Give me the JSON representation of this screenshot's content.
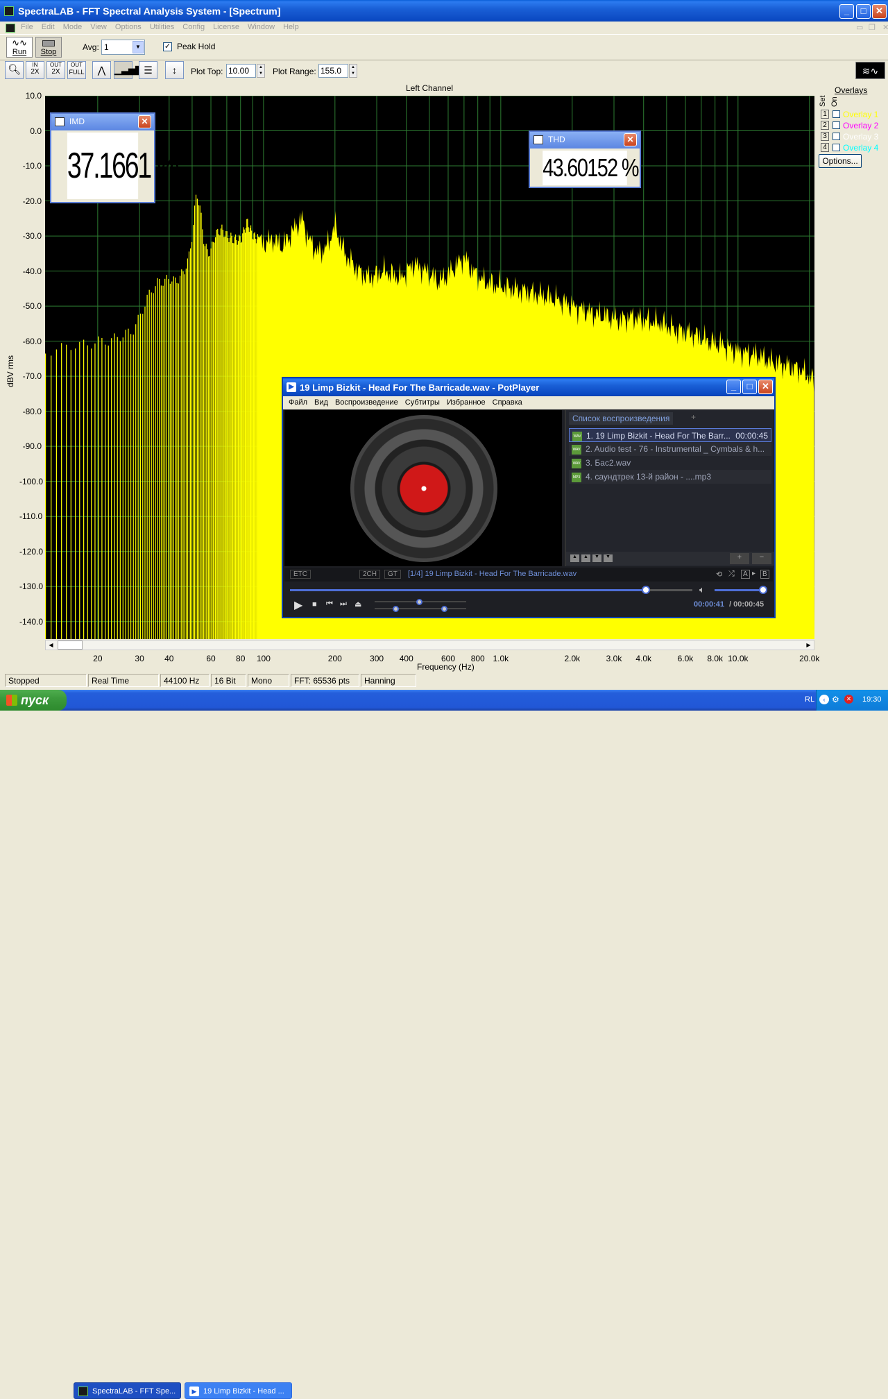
{
  "main_window": {
    "title": "SpectraLAB - FFT Spectral Analysis System - [Spectrum]",
    "menu": [
      "File",
      "Edit",
      "Mode",
      "View",
      "Options",
      "Utilities",
      "Config",
      "License",
      "Window",
      "Help"
    ],
    "run_label": "Run",
    "stop_label": "Stop",
    "avg_label": "Avg:",
    "avg_value": "1",
    "peak_hold_label": "Peak Hold",
    "plot_top_label": "Plot Top:",
    "plot_top_value": "10.00",
    "plot_range_label": "Plot Range:",
    "plot_range_value": "155.0",
    "zoom_buttons": [
      {
        "top": "IN",
        "bottom": "2X"
      },
      {
        "top": "OUT",
        "bottom": "2X"
      },
      {
        "top": "OUT",
        "bottom": "FULL"
      }
    ]
  },
  "chart_data": {
    "type": "bar",
    "title": "Left Channel",
    "xlabel": "Frequency (Hz)",
    "ylabel": "dBV rms",
    "ylim": [
      -145,
      10
    ],
    "xscale": "log",
    "xlim": [
      12,
      21000
    ],
    "y_ticks": [
      "10.0",
      "0.0",
      "-10.0",
      "-20.0",
      "-30.0",
      "-40.0",
      "-50.0",
      "-60.0",
      "-70.0",
      "-80.0",
      "-90.0",
      "-100.0",
      "-110.0",
      "-120.0",
      "-130.0",
      "-140.0"
    ],
    "x_ticks": [
      {
        "label": "20",
        "v": 20
      },
      {
        "label": "30",
        "v": 30
      },
      {
        "label": "40",
        "v": 40
      },
      {
        "label": "60",
        "v": 60
      },
      {
        "label": "80",
        "v": 80
      },
      {
        "label": "100",
        "v": 100
      },
      {
        "label": "200",
        "v": 200
      },
      {
        "label": "300",
        "v": 300
      },
      {
        "label": "400",
        "v": 400
      },
      {
        "label": "600",
        "v": 600
      },
      {
        "label": "800",
        "v": 800
      },
      {
        "label": "1.0k",
        "v": 1000
      },
      {
        "label": "2.0k",
        "v": 2000
      },
      {
        "label": "3.0k",
        "v": 3000
      },
      {
        "label": "4.0k",
        "v": 4000
      },
      {
        "label": "6.0k",
        "v": 6000
      },
      {
        "label": "8.0k",
        "v": 8000
      },
      {
        "label": "10.0k",
        "v": 10000
      },
      {
        "label": "20.0k",
        "v": 20000
      }
    ],
    "spectrum": [
      [
        12,
        -63
      ],
      [
        14,
        -62
      ],
      [
        16,
        -61
      ],
      [
        18,
        -61
      ],
      [
        20,
        -60
      ],
      [
        22,
        -60
      ],
      [
        24,
        -59
      ],
      [
        26,
        -58
      ],
      [
        28,
        -57
      ],
      [
        30,
        -53
      ],
      [
        32,
        -48
      ],
      [
        34,
        -45
      ],
      [
        36,
        -43
      ],
      [
        38,
        -43
      ],
      [
        40,
        -42
      ],
      [
        42,
        -43
      ],
      [
        44,
        -42
      ],
      [
        46,
        -40
      ],
      [
        48,
        -37
      ],
      [
        50,
        -29
      ],
      [
        52,
        -17
      ],
      [
        54,
        -23
      ],
      [
        56,
        -32
      ],
      [
        58,
        -35
      ],
      [
        60,
        -34
      ],
      [
        62,
        -30
      ],
      [
        66,
        -28
      ],
      [
        70,
        -30
      ],
      [
        75,
        -31
      ],
      [
        80,
        -31
      ],
      [
        85,
        -26
      ],
      [
        90,
        -30
      ],
      [
        100,
        -32
      ],
      [
        110,
        -31
      ],
      [
        120,
        -33
      ],
      [
        135,
        -28
      ],
      [
        145,
        -25
      ],
      [
        155,
        -31
      ],
      [
        170,
        -35
      ],
      [
        185,
        -33
      ],
      [
        200,
        -27
      ],
      [
        220,
        -35
      ],
      [
        250,
        -40
      ],
      [
        280,
        -42
      ],
      [
        320,
        -40
      ],
      [
        380,
        -42
      ],
      [
        430,
        -38
      ],
      [
        480,
        -40
      ],
      [
        550,
        -43
      ],
      [
        600,
        -41
      ],
      [
        700,
        -36
      ],
      [
        760,
        -40
      ],
      [
        850,
        -43
      ],
      [
        950,
        -44
      ],
      [
        1100,
        -45
      ],
      [
        1300,
        -46
      ],
      [
        1500,
        -47
      ],
      [
        1700,
        -48
      ],
      [
        2000,
        -50
      ],
      [
        2400,
        -52
      ],
      [
        2800,
        -53
      ],
      [
        3200,
        -54
      ],
      [
        3600,
        -53
      ],
      [
        4000,
        -54
      ],
      [
        4800,
        -55
      ],
      [
        5500,
        -57
      ],
      [
        6500,
        -58
      ],
      [
        7500,
        -60
      ],
      [
        8500,
        -61
      ],
      [
        10000,
        -63
      ],
      [
        12000,
        -64
      ],
      [
        14000,
        -66
      ],
      [
        16000,
        -67
      ],
      [
        18000,
        -68
      ],
      [
        20000,
        -70
      ],
      [
        21000,
        -72
      ]
    ],
    "series_color": "#FFFF00"
  },
  "overlays": {
    "title": "Overlays",
    "set_label": "Set",
    "on_label": "On",
    "items": [
      {
        "num": "1",
        "name": "Overlay 1",
        "color": "#FFFF00"
      },
      {
        "num": "2",
        "name": "Overlay 2",
        "color": "#FF00FF"
      },
      {
        "num": "3",
        "name": "Overlay 3",
        "color": "#FFFFFF"
      },
      {
        "num": "4",
        "name": "Overlay 4",
        "color": "#00FFFF"
      }
    ],
    "options_label": "Options..."
  },
  "imd": {
    "title": "IMD",
    "value": "37.1661 %"
  },
  "thd": {
    "title": "THD",
    "value": "43.60152 %"
  },
  "status_bar": [
    "Stopped",
    "Real Time",
    "44100 Hz",
    "16 Bit",
    "Mono",
    "FFT: 65536 pts",
    "Hanning"
  ],
  "potplayer": {
    "title": "19 Limp Bizkit - Head For The Barricade.wav - PotPlayer",
    "menu": [
      "Файл",
      "Вид",
      "Воспроизведение",
      "Субтитры",
      "Избранное",
      "Справка"
    ],
    "playlist_tab": "Список воспроизведения",
    "playlist_add": "+",
    "playlist": [
      {
        "name": "1. 19 Limp Bizkit - Head For The Barr...",
        "duration": "00:00:45",
        "type": "WAV"
      },
      {
        "name": "2. Audio test - 76 - Instrumental _ Cymbals & h...",
        "duration": "",
        "type": "WAV"
      },
      {
        "name": "3. Бас2.wav",
        "duration": "",
        "type": "WAV"
      },
      {
        "name": "4. саундтрек 13-й район - ....mp3",
        "duration": "",
        "type": "MP3"
      }
    ],
    "etc_label": "ETC",
    "ch_label": "2CH",
    "gt_label": "GT",
    "now_playing": "[1/4] 19 Limp Bizkit - Head For The Barricade.wav",
    "time_current": "00:00:41",
    "time_total": "/ 00:00:45",
    "progress": 0.885,
    "volume": 0.95
  },
  "taskbar": {
    "start_label": "пуск",
    "tasks": [
      "SpectraLAB - FFT Spe...",
      "19 Limp Bizkit - Head ..."
    ],
    "lang": "RL",
    "clock": "19:30"
  }
}
